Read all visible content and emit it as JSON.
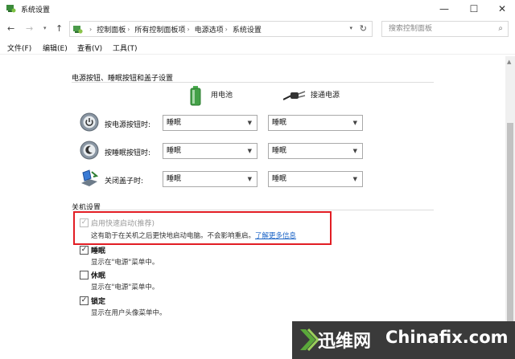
{
  "window": {
    "title": "系统设置",
    "minimize_glyph": "—",
    "maximize_glyph": "☐",
    "close_glyph": "✕"
  },
  "address": {
    "back": "←",
    "forward": "→",
    "up": "↑",
    "crumbs": [
      "控制面板",
      "所有控制面板项",
      "电源选项",
      "系统设置"
    ],
    "crumb_separator": "›",
    "search_placeholder": "搜索控制面板"
  },
  "menu": [
    {
      "label": "文件(F)"
    },
    {
      "label": "编辑(E)"
    },
    {
      "label": "查看(V)"
    },
    {
      "label": "工具(T)"
    }
  ],
  "power_section": {
    "title": "电源按钮、睡眠按钮和盖子设置",
    "col_battery": "用电池",
    "col_plugged": "接通电源",
    "rows": [
      {
        "label": "按电源按钮时:",
        "icon": "power-button-icon",
        "battery": "睡眠",
        "plugged": "睡眠"
      },
      {
        "label": "按睡眠按钮时:",
        "icon": "sleep-button-icon",
        "battery": "睡眠",
        "plugged": "睡眠"
      },
      {
        "label": "关闭盖子时:",
        "icon": "laptop-lid-icon",
        "battery": "睡眠",
        "plugged": "睡眠"
      }
    ]
  },
  "shutdown_section": {
    "title": "关机设置",
    "fast_startup": {
      "label": "启用快速启动(推荐)",
      "desc": "这有助于在关机之后更快地启动电脑。不会影响重启。",
      "link": "了解更多信息",
      "checked": true,
      "disabled": true
    },
    "items": [
      {
        "label": "睡眠",
        "desc": "显示在\"电源\"菜单中。",
        "checked": true
      },
      {
        "label": "休眠",
        "desc": "显示在\"电源\"菜单中。",
        "checked": false
      },
      {
        "label": "锁定",
        "desc": "显示在用户头像菜单中。",
        "checked": true
      }
    ]
  },
  "watermark": {
    "brand": "迅维网",
    "site": "Chinafix.com"
  },
  "colors": {
    "highlight": "#e21d24",
    "link": "#1a63c6",
    "watermark_bg": "#3a3a3a"
  }
}
